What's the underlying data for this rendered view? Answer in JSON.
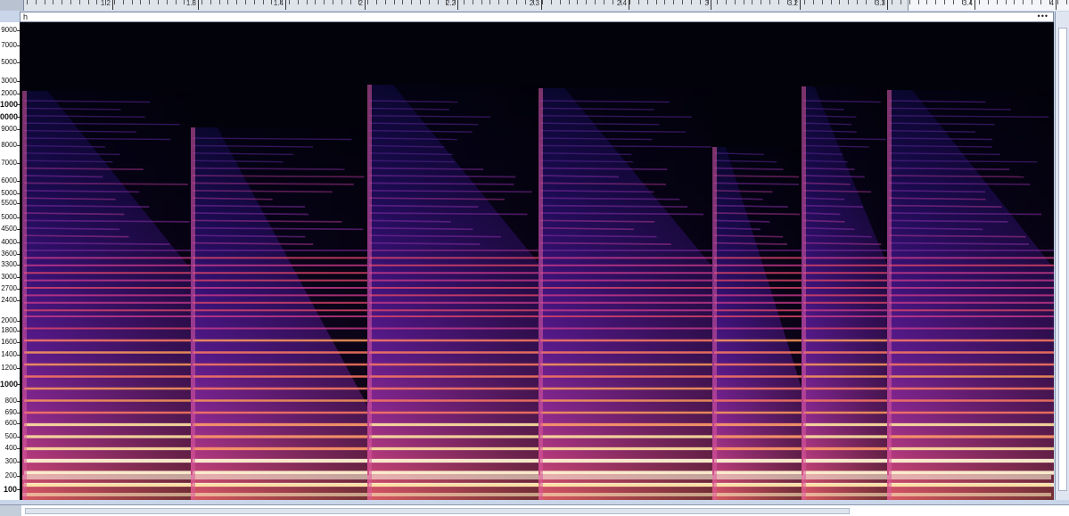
{
  "track": {
    "name": "h",
    "menu_label": "•••"
  },
  "timeline": {
    "labels": [
      "1.2",
      "1.3",
      "1.4",
      "2",
      "2.2",
      "2.3",
      "2.4",
      "3",
      "3.2",
      "3.3",
      "3.4",
      "4"
    ]
  },
  "frequency_axis": {
    "labels": [
      "9000",
      "7000",
      "5000",
      "3000",
      "2000",
      "1000",
      "0000",
      "9000",
      "8000",
      "7000",
      "6000",
      "5000",
      "5500",
      "5000",
      "4500",
      "4000",
      "3600",
      "3300",
      "3000",
      "2700",
      "2400",
      "2000",
      "1800",
      "1600",
      "1400",
      "1200",
      "1000",
      "800",
      "690",
      "600",
      "500",
      "400",
      "300",
      "200",
      "100",
      "10",
      "0000"
    ],
    "bold_labels": [
      "0000",
      "1000",
      "100",
      "10"
    ]
  },
  "colors": {
    "background": "#02020a",
    "low": "#1b0a4a",
    "mid": "#7a1fa0",
    "high": "#e0456a",
    "peak": "#ffc76a",
    "white": "#fff6dc"
  }
}
